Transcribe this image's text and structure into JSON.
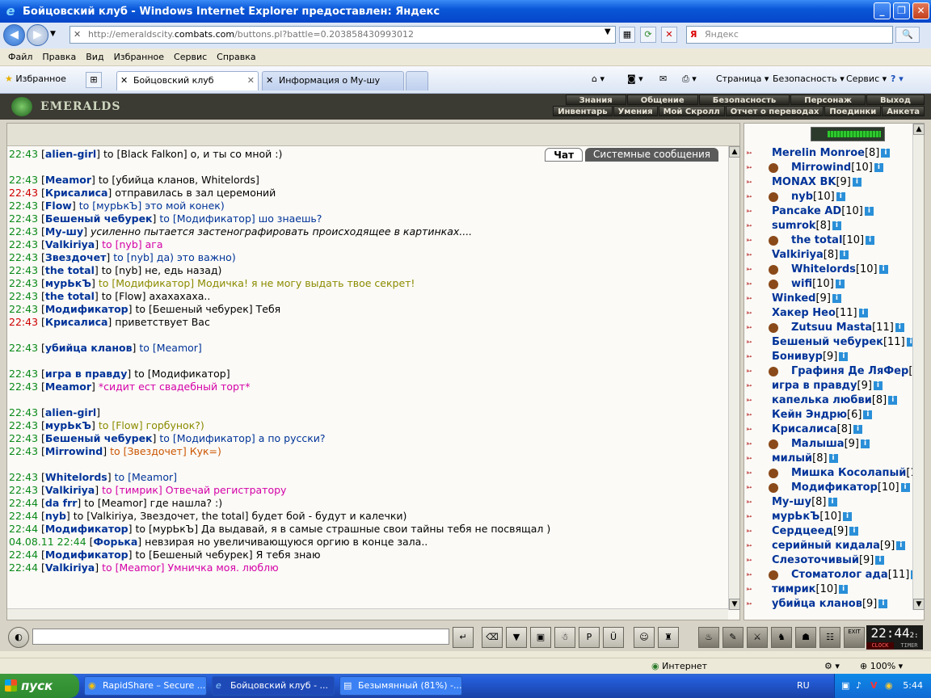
{
  "window": {
    "title": "Бойцовский клуб - Windows Internet Explorer предоставлен: Яндекс"
  },
  "address": {
    "prefix": "http://emeraldscity.",
    "domain": "combats.com",
    "suffix": "/buttons.pl?battle=0.203858430993012",
    "search_placeholder": "Яндекс"
  },
  "menu": [
    "Файл",
    "Правка",
    "Вид",
    "Избранное",
    "Сервис",
    "Справка"
  ],
  "tabs": {
    "favorites": "Избранное",
    "tab1": "Бойцовский клуб",
    "tab2": "Информация о Му-шу"
  },
  "commands": {
    "page": "Страница",
    "safety": "Безопасность",
    "service": "Сервис"
  },
  "game": {
    "logo": "EMERALDS",
    "nav1": [
      "Знания",
      "Общение",
      "Безопасность",
      "Персонаж",
      "Выход"
    ],
    "nav2": [
      "Инвентарь",
      "Умения",
      "Мой Скролл",
      "Отчет о переводах",
      "Поединки",
      "Анкета"
    ],
    "chat_tabs": [
      "Чат",
      "Системные сообщения"
    ]
  },
  "messages": [
    {
      "time": "22:43",
      "nick": "alien-girl",
      "to": "to [Black Falkon]",
      "text": "о, и ты со мной :)",
      "cls": "dark",
      "tall": false
    },
    {
      "time": "22:43",
      "nick": "Meamor",
      "to": "to [убийца кланов, Whitelords]",
      "text": "",
      "cls": "dark",
      "tall": true
    },
    {
      "time": "22:43",
      "nick": "Крисалиса",
      "to": "",
      "text": "отправилась в зал церемоний",
      "cls": "dark",
      "tall": false,
      "red": true
    },
    {
      "time": "22:43",
      "nick": "Flow",
      "to": "to [мурЬкЪ]",
      "text": "это мой конек)",
      "cls": "to",
      "tall": false
    },
    {
      "time": "22:43",
      "nick": "Бешеный чебурек",
      "to": "to [Модификатор]",
      "text": "шо знаешь?",
      "cls": "to",
      "tall": false
    },
    {
      "time": "22:43",
      "nick": "Му-шу",
      "to": "",
      "text": "усиленно пытается застенографировать происходящее в картинках....",
      "cls": "dark",
      "tall": false,
      "italic": true
    },
    {
      "time": "22:43",
      "nick": "Valkiriya",
      "to": "to [nyb]",
      "text": "ага",
      "cls": "pink",
      "tall": false
    },
    {
      "time": "22:43",
      "nick": "Звездочет",
      "to": "to [nyb]",
      "text": "да) это важно)",
      "cls": "to",
      "tall": false
    },
    {
      "time": "22:43",
      "nick": "the total",
      "to": "to [nyb]",
      "text": "не, едь назад)",
      "cls": "dark",
      "tall": false
    },
    {
      "time": "22:43",
      "nick": "мурЬкЪ",
      "to": "to [Модификатор]",
      "text": "Модичка! я не могу выдать твое секрет!",
      "cls": "olive",
      "tall": false
    },
    {
      "time": "22:43",
      "nick": "the total",
      "to": "to [Flow]",
      "text": "ахахахаха..",
      "cls": "dark",
      "tall": false
    },
    {
      "time": "22:43",
      "nick": "Модификатор",
      "to": "to [Бешеный чебурек]",
      "text": "Тебя",
      "cls": "dark",
      "tall": false
    },
    {
      "time": "22:43",
      "nick": "Крисалиса",
      "to": "",
      "text": "приветствует Вас",
      "cls": "dark",
      "tall": false,
      "red": true
    },
    {
      "time": "22:43",
      "nick": "убийца кланов",
      "to": "to [Meamor]",
      "text": "",
      "cls": "to",
      "tall": true
    },
    {
      "time": "22:43",
      "nick": "игра в правду",
      "to": "to [Модификатор]",
      "text": "",
      "cls": "dark",
      "tall": true
    },
    {
      "time": "22:43",
      "nick": "Meamor",
      "to": "",
      "text": "*сидит ест свадебный торт*",
      "cls": "pink",
      "tall": false
    },
    {
      "time": "22:43",
      "nick": "alien-girl",
      "to": "",
      "text": "",
      "cls": "dark",
      "tall": true
    },
    {
      "time": "22:43",
      "nick": "мурЬкЪ",
      "to": "to [Flow]",
      "text": "горбунок?)",
      "cls": "olive",
      "tall": false
    },
    {
      "time": "22:43",
      "nick": "Бешеный чебурек",
      "to": "to [Модификатор]",
      "text": "а по русски?",
      "cls": "to",
      "tall": false
    },
    {
      "time": "22:43",
      "nick": "Mirrowind",
      "to": "to [Звездочет]",
      "text": "Кук=)",
      "cls": "orange",
      "tall": false
    },
    {
      "time": "22:43",
      "nick": "Whitelords",
      "to": "to [Meamor]",
      "text": "",
      "cls": "to",
      "tall": true
    },
    {
      "time": "22:43",
      "nick": "Valkiriya",
      "to": "to [тимрик]",
      "text": "Отвечай регистратору",
      "cls": "pink",
      "tall": false
    },
    {
      "time": "22:44",
      "nick": "da frr",
      "to": "to [Meamor]",
      "text": "где нашла? :)",
      "cls": "dark",
      "tall": false
    },
    {
      "time": "22:44",
      "nick": "nyb",
      "to": "to [Valkiriya, Звездочет, the total]",
      "text": "будет бой - будут и калечки)",
      "cls": "dark",
      "tall": false
    },
    {
      "time": "22:44",
      "nick": "Модификатор",
      "to": "to [мурЬкЪ]",
      "text": "Да выдавай, я в самые страшные свои тайны тебя не посвящал )",
      "cls": "dark",
      "tall": false
    },
    {
      "time": "04.08.11 22:44",
      "nick": "Форька",
      "to": "",
      "text": "невзирая но увеличивающуюся оргию в конце зала..",
      "cls": "dark",
      "tall": false
    },
    {
      "time": "22:44",
      "nick": "Модификатор",
      "to": "to [Бешеный чебурек]",
      "text": "Я тебя знаю",
      "cls": "dark",
      "tall": false
    },
    {
      "time": "22:44",
      "nick": "Valkiriya",
      "to": "to [Meamor]",
      "text": "Умничка моя. люблю",
      "cls": "pink",
      "tall": false
    }
  ],
  "users": [
    {
      "name": "Merelin Monroe",
      "lvl": "[8]",
      "ind": false
    },
    {
      "name": "Mirrowind",
      "lvl": "[10]",
      "ind": true
    },
    {
      "name": "MONAX BK",
      "lvl": "[9]",
      "ind": false
    },
    {
      "name": "nyb",
      "lvl": "[10]",
      "ind": true
    },
    {
      "name": "Pancake AD",
      "lvl": "[10]",
      "ind": false
    },
    {
      "name": "sumrok",
      "lvl": "[8]",
      "ind": false
    },
    {
      "name": "the total",
      "lvl": "[10]",
      "ind": true
    },
    {
      "name": "Valkiriya",
      "lvl": "[8]",
      "ind": false
    },
    {
      "name": "Whitelords",
      "lvl": "[10]",
      "ind": true
    },
    {
      "name": "wifi",
      "lvl": "[10]",
      "ind": true
    },
    {
      "name": "Winked",
      "lvl": "[9]",
      "ind": false
    },
    {
      "name": "Хакер Нео",
      "lvl": "[11]",
      "ind": false
    },
    {
      "name": "Zutsuu Masta",
      "lvl": "[11]",
      "ind": true
    },
    {
      "name": "Бешеный чебурек",
      "lvl": "[11]",
      "ind": false
    },
    {
      "name": "Бонивур",
      "lvl": "[9]",
      "ind": false
    },
    {
      "name": "Графиня Де ЛяФер",
      "lvl": "[",
      "ind": true
    },
    {
      "name": "игра в правду",
      "lvl": "[9]",
      "ind": false
    },
    {
      "name": "капелька любви",
      "lvl": "[8]",
      "ind": false
    },
    {
      "name": "Кейн Эндрю",
      "lvl": "[6]",
      "ind": false
    },
    {
      "name": "Крисалиса",
      "lvl": "[8]",
      "ind": false
    },
    {
      "name": "Малыша",
      "lvl": "[9]",
      "ind": true
    },
    {
      "name": "милый",
      "lvl": "[8]",
      "ind": false
    },
    {
      "name": "Мишка Косолапый",
      "lvl": "[1",
      "ind": true
    },
    {
      "name": "Модификатор",
      "lvl": "[10]",
      "ind": true
    },
    {
      "name": "Му-шу",
      "lvl": "[8]",
      "ind": false
    },
    {
      "name": "мурЬкЪ",
      "lvl": "[10]",
      "ind": false
    },
    {
      "name": "Сердцеед",
      "lvl": "[9]",
      "ind": false
    },
    {
      "name": "серийный кидала",
      "lvl": "[9]",
      "ind": false
    },
    {
      "name": "Слезоточивый",
      "lvl": "[9]",
      "ind": false
    },
    {
      "name": "Стоматолог ада",
      "lvl": "[11]",
      "ind": true
    },
    {
      "name": "тимрик",
      "lvl": "[10]",
      "ind": false
    },
    {
      "name": "убийца кланов",
      "lvl": "[9]",
      "ind": false
    }
  ],
  "clock": {
    "time": "22:44",
    "sub": "2:",
    "clock_label": "CLOCK",
    "timer_label": "TIMER",
    "exit": "EXIT"
  },
  "status": {
    "zone": "Интернет",
    "zoom": "100%"
  },
  "taskbar": {
    "start": "пуск",
    "tasks": [
      "RapidShare – Secure ...",
      "Бойцовский клуб - ...",
      "Безымянный (81%) -..."
    ],
    "lang": "RU",
    "time": "5:44"
  }
}
